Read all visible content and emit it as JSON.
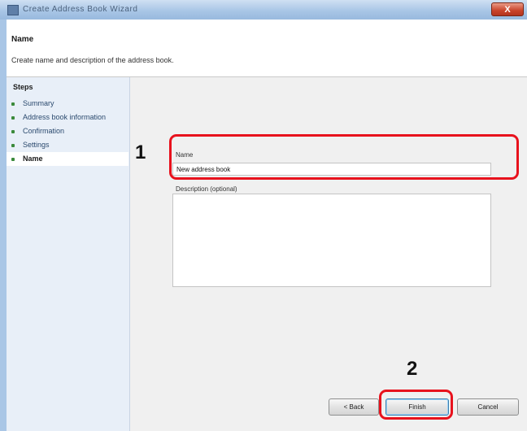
{
  "window": {
    "title": "Create Address Book Wizard",
    "close_label": "X"
  },
  "header": {
    "heading": "Name",
    "description": "Create name and description of the address book."
  },
  "sidebar": {
    "heading": "Steps",
    "steps": [
      {
        "label": "Summary",
        "current": false
      },
      {
        "label": "Address book information",
        "current": false
      },
      {
        "label": "Confirmation",
        "current": false
      },
      {
        "label": "Settings",
        "current": false
      },
      {
        "label": "Name",
        "current": true
      }
    ]
  },
  "form": {
    "name_label": "Name",
    "name_value": "New address book",
    "description_label": "Description (optional)",
    "description_value": ""
  },
  "buttons": {
    "back": "< Back",
    "finish": "Finish",
    "cancel": "Cancel"
  },
  "annotations": {
    "callout_1": "1",
    "callout_2": "2"
  },
  "colors": {
    "callout_red": "#e8121d",
    "titlebar_blue": "#a9c6e6",
    "close_red": "#c9432b"
  }
}
